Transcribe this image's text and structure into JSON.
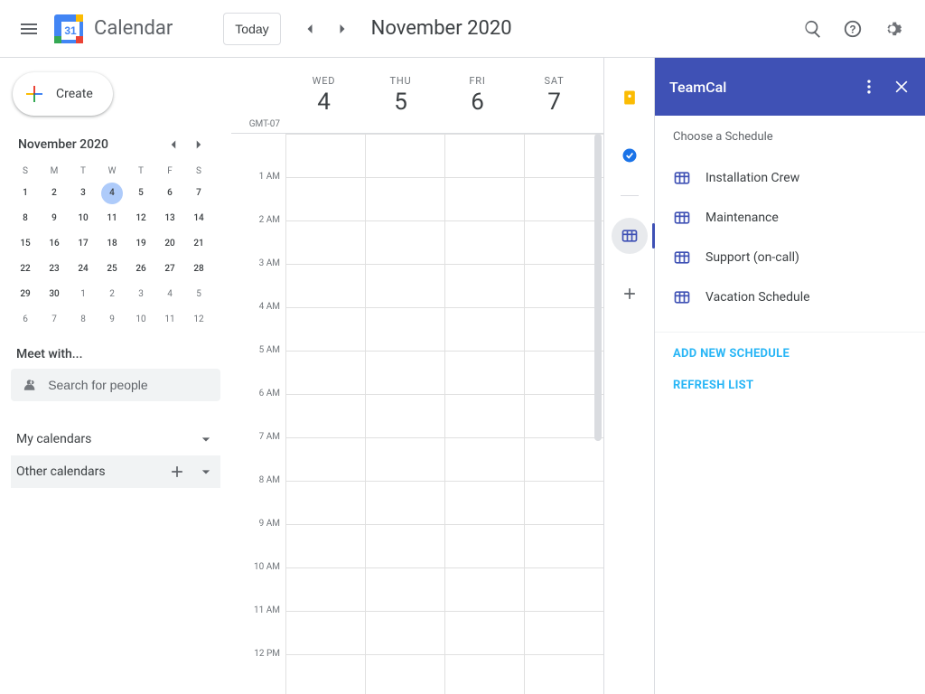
{
  "header": {
    "app_title": "Calendar",
    "today_label": "Today",
    "current_label": "November 2020"
  },
  "sidebar": {
    "create_label": "Create",
    "mini_month_label": "November 2020",
    "dows": [
      "S",
      "M",
      "T",
      "W",
      "T",
      "F",
      "S"
    ],
    "days": [
      {
        "n": "1",
        "sel": false,
        "other": false
      },
      {
        "n": "2",
        "sel": false,
        "other": false
      },
      {
        "n": "3",
        "sel": false,
        "other": false
      },
      {
        "n": "4",
        "sel": true,
        "other": false
      },
      {
        "n": "5",
        "sel": false,
        "other": false
      },
      {
        "n": "6",
        "sel": false,
        "other": false
      },
      {
        "n": "7",
        "sel": false,
        "other": false
      },
      {
        "n": "8",
        "sel": false,
        "other": false
      },
      {
        "n": "9",
        "sel": false,
        "other": false
      },
      {
        "n": "10",
        "sel": false,
        "other": false
      },
      {
        "n": "11",
        "sel": false,
        "other": false
      },
      {
        "n": "12",
        "sel": false,
        "other": false
      },
      {
        "n": "13",
        "sel": false,
        "other": false
      },
      {
        "n": "14",
        "sel": false,
        "other": false
      },
      {
        "n": "15",
        "sel": false,
        "other": false
      },
      {
        "n": "16",
        "sel": false,
        "other": false
      },
      {
        "n": "17",
        "sel": false,
        "other": false
      },
      {
        "n": "18",
        "sel": false,
        "other": false
      },
      {
        "n": "19",
        "sel": false,
        "other": false
      },
      {
        "n": "20",
        "sel": false,
        "other": false
      },
      {
        "n": "21",
        "sel": false,
        "other": false
      },
      {
        "n": "22",
        "sel": false,
        "other": false
      },
      {
        "n": "23",
        "sel": false,
        "other": false
      },
      {
        "n": "24",
        "sel": false,
        "other": false
      },
      {
        "n": "25",
        "sel": false,
        "other": false
      },
      {
        "n": "26",
        "sel": false,
        "other": false
      },
      {
        "n": "27",
        "sel": false,
        "other": false
      },
      {
        "n": "28",
        "sel": false,
        "other": false
      },
      {
        "n": "29",
        "sel": false,
        "other": false
      },
      {
        "n": "30",
        "sel": false,
        "other": false
      },
      {
        "n": "1",
        "sel": false,
        "other": true
      },
      {
        "n": "2",
        "sel": false,
        "other": true
      },
      {
        "n": "3",
        "sel": false,
        "other": true
      },
      {
        "n": "4",
        "sel": false,
        "other": true
      },
      {
        "n": "5",
        "sel": false,
        "other": true
      },
      {
        "n": "6",
        "sel": false,
        "other": true
      },
      {
        "n": "7",
        "sel": false,
        "other": true
      },
      {
        "n": "8",
        "sel": false,
        "other": true
      },
      {
        "n": "9",
        "sel": false,
        "other": true
      },
      {
        "n": "10",
        "sel": false,
        "other": true
      },
      {
        "n": "11",
        "sel": false,
        "other": true
      },
      {
        "n": "12",
        "sel": false,
        "other": true
      }
    ],
    "meet_with_label": "Meet with...",
    "search_placeholder": "Search for people",
    "my_calendars_label": "My calendars",
    "other_calendars_label": "Other calendars"
  },
  "grid": {
    "tz": "GMT-07",
    "day_headers": [
      {
        "dow": "WED",
        "num": "4"
      },
      {
        "dow": "THU",
        "num": "5"
      },
      {
        "dow": "FRI",
        "num": "6"
      },
      {
        "dow": "SAT",
        "num": "7"
      }
    ],
    "hours": [
      "",
      "1 AM",
      "2 AM",
      "3 AM",
      "4 AM",
      "5 AM",
      "6 AM",
      "7 AM",
      "8 AM",
      "9 AM",
      "10 AM",
      "11 AM",
      "12 PM"
    ]
  },
  "teamcal": {
    "title": "TeamCal",
    "choose_label": "Choose a Schedule",
    "schedules": [
      "Installation Crew",
      "Maintenance",
      "Support (on-call)",
      "Vacation Schedule"
    ],
    "add_new_label": "ADD NEW SCHEDULE",
    "refresh_label": "REFRESH LIST"
  },
  "colors": {
    "brand": "#3f51b5",
    "accent": "#29b6f6"
  }
}
